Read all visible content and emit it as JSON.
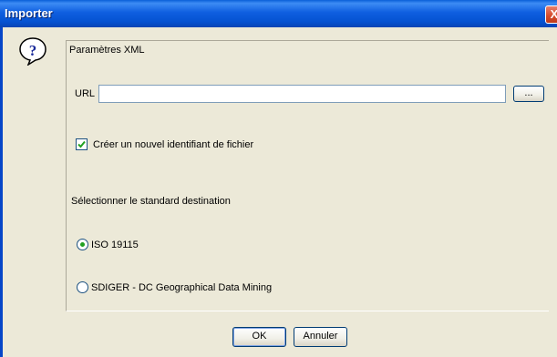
{
  "window": {
    "title": "Importer",
    "close_glyph": "X"
  },
  "section": {
    "heading": "Paramètres XML"
  },
  "url": {
    "label": "URL",
    "value": "",
    "browse_label": "..."
  },
  "options": {
    "new_identifier_label": "Créer un nouvel identifiant de fichier",
    "new_identifier_checked": true
  },
  "standard": {
    "heading": "Sélectionner le standard destination",
    "choices": [
      {
        "label": "ISO 19115",
        "selected": true
      },
      {
        "label": "SDIGER - DC Geographical Data Mining",
        "selected": false
      }
    ]
  },
  "buttons": {
    "ok": "OK",
    "cancel": "Annuler"
  },
  "icons": {
    "dialog": "question-balloon-icon",
    "close": "close-icon",
    "checkbox_mark": "checkmark-icon"
  },
  "colors": {
    "titlebar": "#0552d1",
    "dialog_bg": "#ece9d8",
    "close_button": "#d44a2a",
    "radio_selected": "#21a121"
  }
}
